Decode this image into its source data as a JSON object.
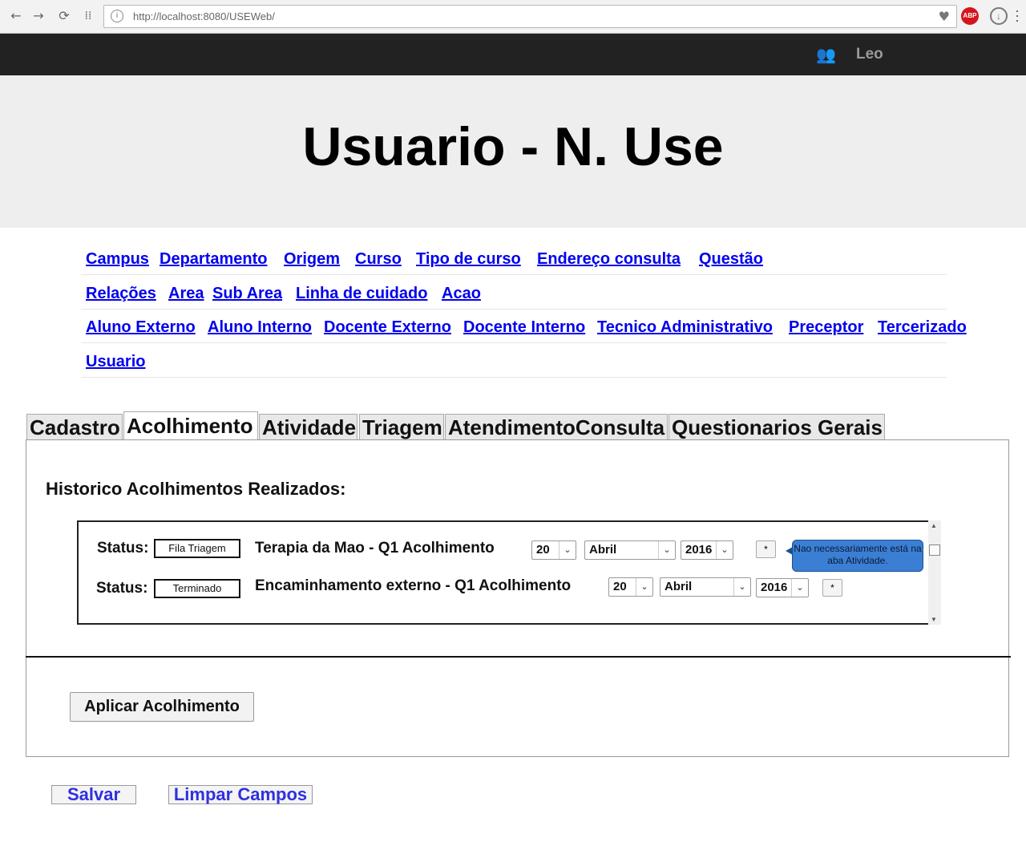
{
  "browser": {
    "url": "http://localhost:8080/USEWeb/",
    "back_icon": "arrow-left-icon",
    "forward_icon": "arrow-right-icon",
    "reload_icon": "reload-icon",
    "apps_icon": "apps-grid-icon",
    "abp_label": "ABP"
  },
  "header": {
    "user_name": "Leo",
    "title": "Usuario - N. Use"
  },
  "nav": {
    "row1": [
      "Campus",
      "Departamento",
      "Origem",
      "Curso",
      "Tipo de curso",
      "Endereço consulta",
      "Questão"
    ],
    "row2": [
      "Relações",
      "Area",
      "Sub Area",
      "Linha de cuidado",
      "Acao"
    ],
    "row3": [
      "Aluno Externo",
      "Aluno Interno",
      "Docente Externo",
      "Docente Interno",
      "Tecnico Administrativo",
      "Preceptor",
      "Tercerizado"
    ],
    "row4": [
      "Usuario"
    ]
  },
  "tabs": [
    "Cadastro",
    "Acolhimento",
    "Atividade",
    "Triagem",
    "AtendimentoConsulta",
    "Questionarios Gerais"
  ],
  "active_tab": "Acolhimento",
  "panel": {
    "heading": "Historico Acolhimentos Realizados:",
    "rows": [
      {
        "status_label": "Status:",
        "status": "Fila Triagem",
        "title": "Terapia da Mao - Q1 Acolhimento",
        "day": "20",
        "month": "Abril",
        "year": "2016",
        "star": "*"
      },
      {
        "status_label": "Status:",
        "status": "Terminado",
        "title": "Encaminhamento externo - Q1 Acolhimento",
        "day": "20",
        "month": "Abril",
        "year": "2016",
        "star": "*"
      }
    ],
    "tooltip": "Nao necessariamente está na aba Atividade.",
    "apply_button": "Aplicar Acolhimento"
  },
  "actions": {
    "save": "Salvar",
    "clear": "Limpar Campos"
  },
  "colors": {
    "topbar": "#222222",
    "hero": "#eeeeee",
    "link": "#0000ee",
    "tooltip": "#3b7fd4"
  }
}
